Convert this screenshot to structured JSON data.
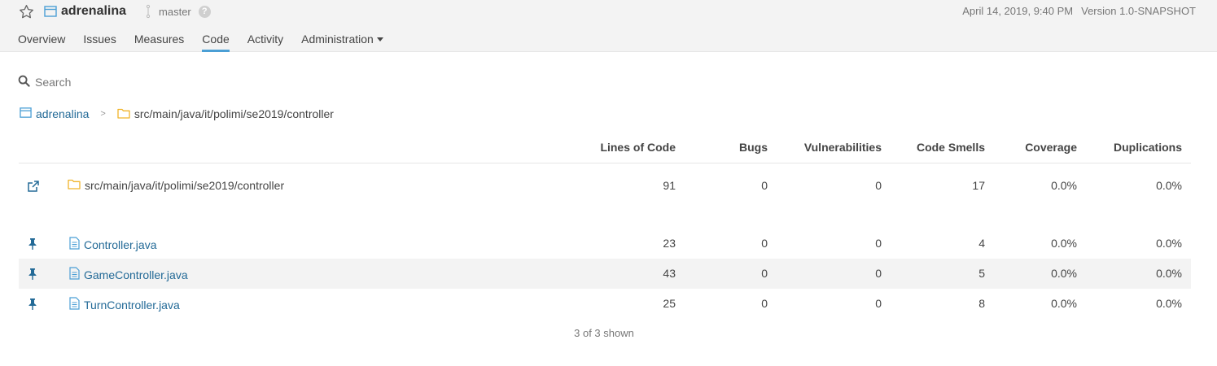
{
  "header": {
    "project_name": "adrenalina",
    "branch": "master",
    "help": "?",
    "date": "April 14, 2019, 9:40 PM",
    "version": "Version 1.0-SNAPSHOT"
  },
  "nav": {
    "tabs": [
      "Overview",
      "Issues",
      "Measures",
      "Code",
      "Activity",
      "Administration"
    ],
    "active": "Code"
  },
  "search": {
    "placeholder": "Search"
  },
  "breadcrumb": {
    "root": "adrenalina",
    "separator": ">",
    "current": "src/main/java/it/polimi/se2019/controller"
  },
  "table": {
    "columns": [
      "Lines of Code",
      "Bugs",
      "Vulnerabilities",
      "Code Smells",
      "Coverage",
      "Duplications"
    ],
    "base": {
      "name": "src/main/java/it/polimi/se2019/controller",
      "loc": "91",
      "bugs": "0",
      "vulns": "0",
      "smells": "17",
      "coverage": "0.0%",
      "dup": "0.0%"
    },
    "files": [
      {
        "name": "Controller.java",
        "loc": "23",
        "bugs": "0",
        "vulns": "0",
        "smells": "4",
        "coverage": "0.0%",
        "dup": "0.0%"
      },
      {
        "name": "GameController.java",
        "loc": "43",
        "bugs": "0",
        "vulns": "0",
        "smells": "5",
        "coverage": "0.0%",
        "dup": "0.0%"
      },
      {
        "name": "TurnController.java",
        "loc": "25",
        "bugs": "0",
        "vulns": "0",
        "smells": "8",
        "coverage": "0.0%",
        "dup": "0.0%"
      }
    ]
  },
  "footer": {
    "shown": "3 of 3 shown"
  },
  "colors": {
    "link": "#236a97",
    "accent": "#4b9fd5",
    "folder": "#f0b429",
    "topbar": "#f3f3f3"
  },
  "icons": [
    "star-icon",
    "project-icon",
    "branch-icon",
    "help-icon",
    "search-icon",
    "folder-icon",
    "open-external-icon",
    "pin-icon",
    "file-icon"
  ]
}
